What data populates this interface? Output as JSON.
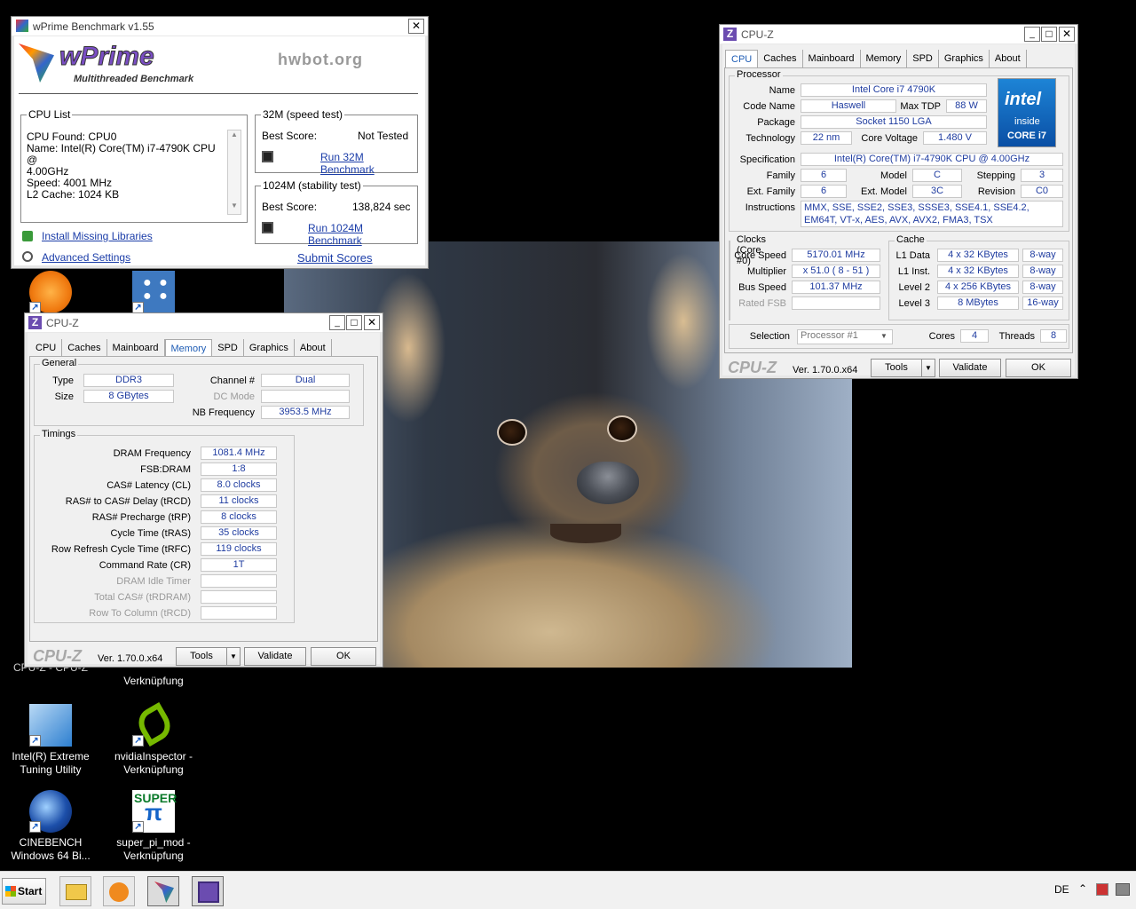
{
  "desktop_icons": [
    {
      "label": "Intel(R) Extreme Tuning Utility"
    },
    {
      "label": "nvidiaInspector - Verknüpfung"
    },
    {
      "label": "CINEBENCH Windows 64 Bi..."
    },
    {
      "label": "super_pi_mod - Verknüpfung"
    },
    {
      "label": "Verknüpfung"
    },
    {
      "label": "CPU-Z - CPU-Z"
    }
  ],
  "wprime": {
    "title": "wPrime Benchmark v1.55",
    "logo": "wPrime",
    "tagline": "Multithreaded Benchmark",
    "hwbot": "hwbot.org",
    "cpu_list_label": "CPU List",
    "cpu_list_lines": [
      "CPU Found: CPU0",
      "Name:   Intel(R) Core(TM) i7-4790K CPU @",
      "4.00GHz",
      "Speed:   4001 MHz",
      "L2 Cache: 1024 KB"
    ],
    "test32_label": "32M (speed test)",
    "test32_best_label": "Best Score:",
    "test32_best_value": "Not Tested",
    "test32_run": "Run 32M Benchmark",
    "test1024_label": "1024M (stability test)",
    "test1024_best_label": "Best Score:",
    "test1024_best_value": "138,824 sec",
    "test1024_run": "Run 1024M Benchmark",
    "install_libs": "Install Missing Libraries",
    "advanced": "Advanced Settings",
    "submit": "Submit Scores",
    "close": "✕"
  },
  "cpuz_cpu": {
    "title": "CPU-Z",
    "tabs": [
      "CPU",
      "Caches",
      "Mainboard",
      "Memory",
      "SPD",
      "Graphics",
      "About"
    ],
    "active_tab": "CPU",
    "processor_label": "Processor",
    "name_label": "Name",
    "name": "Intel Core i7 4790K",
    "codename_label": "Code Name",
    "codename": "Haswell",
    "maxtdp_label": "Max TDP",
    "maxtdp": "88 W",
    "package_label": "Package",
    "package": "Socket 1150 LGA",
    "technology_label": "Technology",
    "technology": "22 nm",
    "corevoltage_label": "Core Voltage",
    "corevoltage": "1.480 V",
    "spec_label": "Specification",
    "spec": "Intel(R) Core(TM) i7-4790K CPU @ 4.00GHz",
    "family_label": "Family",
    "family": "6",
    "model_label": "Model",
    "model": "C",
    "stepping_label": "Stepping",
    "stepping": "3",
    "extfamily_label": "Ext. Family",
    "extfamily": "6",
    "extmodel_label": "Ext. Model",
    "extmodel": "3C",
    "revision_label": "Revision",
    "revision": "C0",
    "instructions_label": "Instructions",
    "instructions": "MMX, SSE, SSE2, SSE3, SSSE3, SSE4.1, SSE4.2, EM64T, VT-x, AES, AVX, AVX2, FMA3, TSX",
    "clocks_label": "Clocks (Core #0)",
    "corespeed_label": "Core Speed",
    "corespeed": "5170.01 MHz",
    "multiplier_label": "Multiplier",
    "multiplier": "x 51.0 ( 8 - 51 )",
    "busspeed_label": "Bus Speed",
    "busspeed": "101.37 MHz",
    "ratedfsb_label": "Rated FSB",
    "ratedfsb": "",
    "cache_label": "Cache",
    "l1d_label": "L1 Data",
    "l1d": "4 x 32 KBytes",
    "l1d_way": "8-way",
    "l1i_label": "L1 Inst.",
    "l1i": "4 x 32 KBytes",
    "l1i_way": "8-way",
    "l2_label": "Level 2",
    "l2": "4 x 256 KBytes",
    "l2_way": "8-way",
    "l3_label": "Level 3",
    "l3": "8 MBytes",
    "l3_way": "16-way",
    "selection_label": "Selection",
    "selection": "Processor #1",
    "cores_label": "Cores",
    "cores": "4",
    "threads_label": "Threads",
    "threads": "8",
    "brand": "CPU-Z",
    "version": "Ver. 1.70.0.x64",
    "tools": "Tools",
    "validate": "Validate",
    "ok": "OK",
    "intel_badge": {
      "brand": "intel",
      "inside": "inside",
      "core": "CORE i7"
    }
  },
  "cpuz_mem": {
    "title": "CPU-Z",
    "tabs": [
      "CPU",
      "Caches",
      "Mainboard",
      "Memory",
      "SPD",
      "Graphics",
      "About"
    ],
    "active_tab": "Memory",
    "general_label": "General",
    "type_label": "Type",
    "type": "DDR3",
    "channel_label": "Channel #",
    "channel": "Dual",
    "size_label": "Size",
    "size": "8 GBytes",
    "dcmode_label": "DC Mode",
    "dcmode": "",
    "nbfreq_label": "NB Frequency",
    "nbfreq": "3953.5 MHz",
    "timings_label": "Timings",
    "timings": [
      {
        "label": "DRAM Frequency",
        "value": "1081.4 MHz",
        "disabled": false
      },
      {
        "label": "FSB:DRAM",
        "value": "1:8",
        "disabled": false
      },
      {
        "label": "CAS# Latency (CL)",
        "value": "8.0 clocks",
        "disabled": false
      },
      {
        "label": "RAS# to CAS# Delay (tRCD)",
        "value": "11 clocks",
        "disabled": false
      },
      {
        "label": "RAS# Precharge (tRP)",
        "value": "8 clocks",
        "disabled": false
      },
      {
        "label": "Cycle Time (tRAS)",
        "value": "35 clocks",
        "disabled": false
      },
      {
        "label": "Row Refresh Cycle Time (tRFC)",
        "value": "119 clocks",
        "disabled": false
      },
      {
        "label": "Command Rate (CR)",
        "value": "1T",
        "disabled": false
      },
      {
        "label": "DRAM Idle Timer",
        "value": "",
        "disabled": true
      },
      {
        "label": "Total CAS# (tRDRAM)",
        "value": "",
        "disabled": true
      },
      {
        "label": "Row To Column (tRCD)",
        "value": "",
        "disabled": true
      }
    ],
    "brand": "CPU-Z",
    "version": "Ver. 1.70.0.x64",
    "tools": "Tools",
    "validate": "Validate",
    "ok": "OK"
  },
  "taskbar": {
    "start": "Start",
    "language": "DE",
    "time": "",
    "pinned": [
      "explorer",
      "media-player",
      "wprime",
      "cpu-z"
    ]
  },
  "colors": {
    "value_text": "#1f3ca0",
    "link": "#1a3ca8",
    "active_tab": "#1f5db5"
  }
}
